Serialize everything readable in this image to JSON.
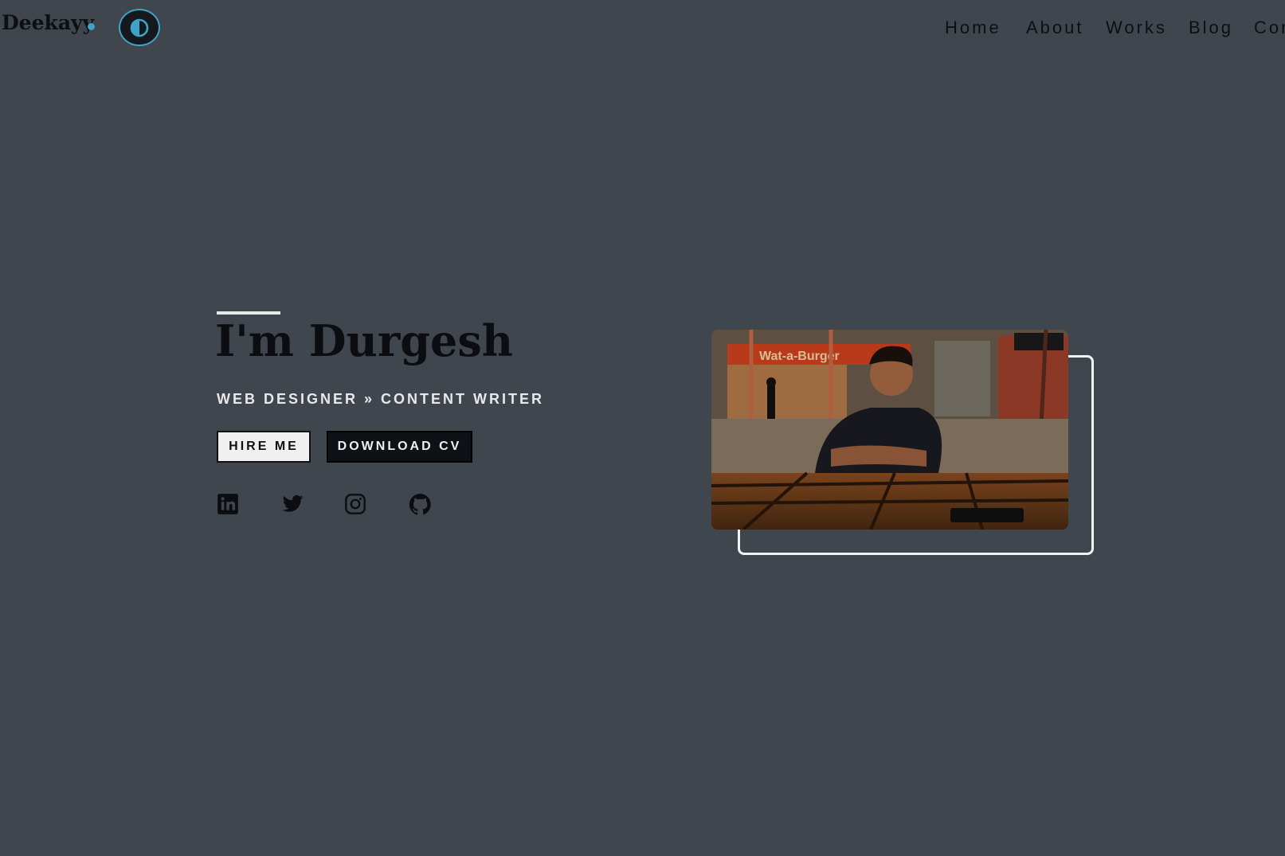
{
  "header": {
    "logo": "Deekayy",
    "nav": [
      "Home",
      "About",
      "Works",
      "Blog",
      "Con"
    ]
  },
  "hero": {
    "title": "I'm Durgesh",
    "role_primary": "WEB DESIGNER",
    "role_separator": "»",
    "role_secondary": "CONTENT WRITER",
    "hire_label": "HIRE ME",
    "cv_label": "DOWNLOAD CV"
  },
  "social_icons": [
    "linkedin-icon",
    "twitter-icon",
    "instagram-icon",
    "github-icon"
  ],
  "photo_sign_text": "Wat-a-Burger",
  "colors": {
    "background": "#40464d",
    "accent": "#3fa3c7",
    "text_dark": "#0d0f12",
    "text_light": "#e9e9e9"
  }
}
